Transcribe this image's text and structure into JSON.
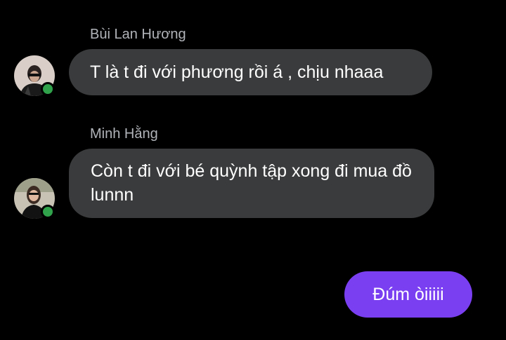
{
  "colors": {
    "background": "#000000",
    "incoming_bubble": "#3a3b3c",
    "outgoing_bubble": "#7b3ff2",
    "name_text": "#b0b3b8",
    "online_indicator": "#31a24c"
  },
  "messages": [
    {
      "sender": "Bùi Lan Hương",
      "avatar_icon": "user-avatar-photo",
      "online": true,
      "text": "T là t đi với phương rồi á , chịu nhaaa",
      "direction": "incoming"
    },
    {
      "sender": "Minh Hằng",
      "avatar_icon": "user-avatar-photo",
      "online": true,
      "text": "Còn t đi với bé quỳnh tập xong đi mua đồ lunnn",
      "direction": "incoming"
    },
    {
      "sender": "",
      "text": "Đúm òiiiii",
      "direction": "outgoing"
    }
  ]
}
